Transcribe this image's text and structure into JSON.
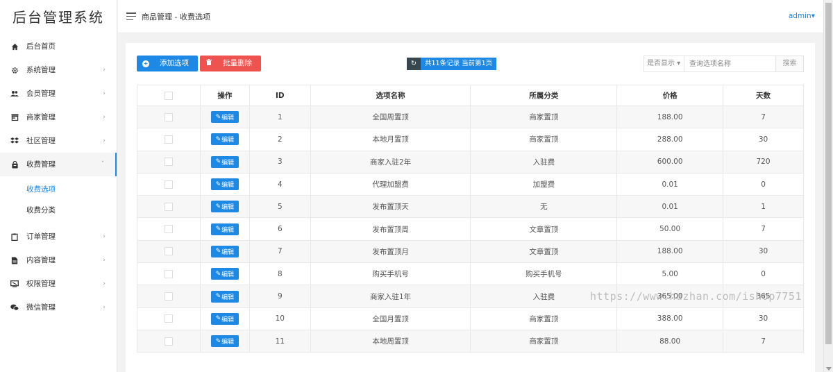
{
  "logo": "后台管理系统",
  "header": {
    "breadcrumb": "商品管理 - 收费选项",
    "user": "admin"
  },
  "sidebar": {
    "items": [
      {
        "label": "后台首页",
        "icon": "home-icon",
        "arrow": ""
      },
      {
        "label": "系统管理",
        "icon": "gear-icon",
        "arrow": "›"
      },
      {
        "label": "会员管理",
        "icon": "users-icon",
        "arrow": "›"
      },
      {
        "label": "商家管理",
        "icon": "store-icon",
        "arrow": "›"
      },
      {
        "label": "社区管理",
        "icon": "community-icon",
        "arrow": "›"
      },
      {
        "label": "收费管理",
        "icon": "shopping-bag-icon",
        "arrow": "ˇ"
      },
      {
        "label": "订单管理",
        "icon": "clipboard-icon",
        "arrow": "›"
      },
      {
        "label": "内容管理",
        "icon": "document-icon",
        "arrow": "›"
      },
      {
        "label": "权限管理",
        "icon": "monitor-icon",
        "arrow": "›"
      },
      {
        "label": "微信管理",
        "icon": "wechat-icon",
        "arrow": "›"
      }
    ],
    "sub_items": [
      {
        "label": "收费选项"
      },
      {
        "label": "收费分类"
      }
    ]
  },
  "toolbar": {
    "add_label": "添加选项",
    "delete_label": "批量删除",
    "count_text": "共11条记录 当前第1页",
    "filter_label": "是否显示",
    "search_placeholder": "查询选项名称",
    "search_button": "搜索"
  },
  "table": {
    "headers": [
      "操作",
      "ID",
      "选项名称",
      "所属分类",
      "价格",
      "天数"
    ],
    "edit_label": "编辑",
    "rows": [
      {
        "id": "1",
        "name": "全国周置顶",
        "category": "商家置顶",
        "price": "188.00",
        "days": "7"
      },
      {
        "id": "2",
        "name": "本地月置顶",
        "category": "商家置顶",
        "price": "288.00",
        "days": "30"
      },
      {
        "id": "3",
        "name": "商家入驻2年",
        "category": "入驻费",
        "price": "600.00",
        "days": "720"
      },
      {
        "id": "4",
        "name": "代理加盟费",
        "category": "加盟费",
        "price": "0.01",
        "days": "0"
      },
      {
        "id": "5",
        "name": "发布置顶天",
        "category": "无",
        "price": "0.01",
        "days": "1"
      },
      {
        "id": "6",
        "name": "发布置顶周",
        "category": "文章置顶",
        "price": "50.00",
        "days": "7"
      },
      {
        "id": "7",
        "name": "发布置顶月",
        "category": "文章置顶",
        "price": "188.00",
        "days": "30"
      },
      {
        "id": "8",
        "name": "购买手机号",
        "category": "购买手机号",
        "price": "5.00",
        "days": "0"
      },
      {
        "id": "9",
        "name": "商家入驻1年",
        "category": "入驻费",
        "price": "365.00",
        "days": "365"
      },
      {
        "id": "10",
        "name": "全国月置顶",
        "category": "商家置顶",
        "price": "388.00",
        "days": "30"
      },
      {
        "id": "11",
        "name": "本地周置顶",
        "category": "商家置顶",
        "price": "88.00",
        "days": "7"
      }
    ]
  },
  "watermark": "https://www.huzhan.com/ishop7751",
  "colors": {
    "primary": "#1e88e5",
    "danger": "#ef5350",
    "dark": "#37474f"
  }
}
